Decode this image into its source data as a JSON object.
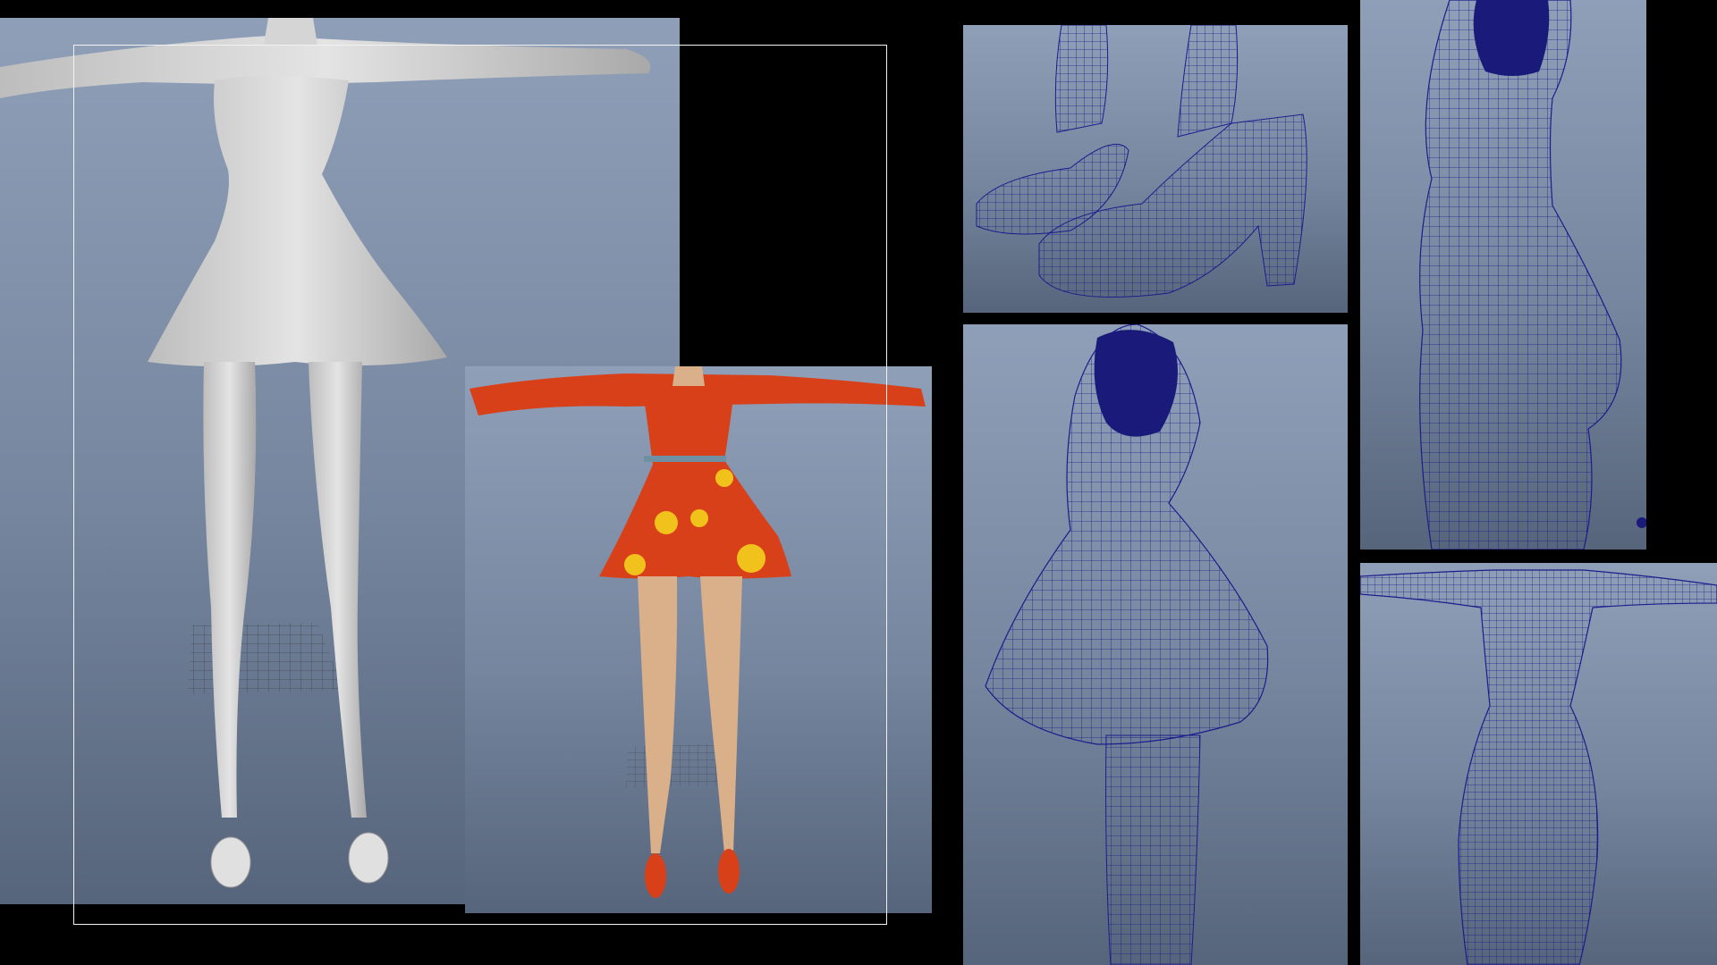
{
  "scene": {
    "description_visible_text": "",
    "colors": {
      "background": "#000000",
      "viewport_top": "#8f9fb8",
      "viewport_bottom": "#56657b",
      "wire": "#1c1c8c",
      "grey_model": "#d6d6d6",
      "dress_red": "#d8401a",
      "dress_dots": "#f2c21c",
      "skin": "#d9b08a",
      "frame_border": "#f2f2f2"
    }
  },
  "viewports": {
    "grey_model": {
      "label": "",
      "icon": "grey-tpose-model"
    },
    "textured_model": {
      "label": "",
      "icon": "textured-tpose-model"
    },
    "wire_shoes": {
      "label": "",
      "icon": "wireframe-shoes"
    },
    "wire_dress": {
      "label": "",
      "icon": "wireframe-dress"
    },
    "wire_side_body": {
      "label": "",
      "icon": "wireframe-side-body"
    },
    "wire_back_body": {
      "label": "",
      "icon": "wireframe-back-body"
    }
  }
}
